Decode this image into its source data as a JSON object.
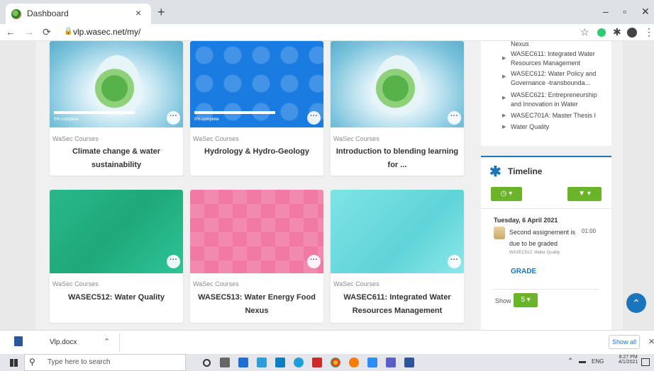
{
  "browser": {
    "tab_title": "Dashboard",
    "tab_close": "×",
    "new_tab": "+",
    "url": "vlp.wasec.net/my/",
    "window_min": "–",
    "window_max": "▫",
    "window_close": "✕"
  },
  "courses": [
    {
      "category": "WaSec Courses",
      "title": "Climate change & water sustainability",
      "progress_label": "0% complete",
      "progress": 0
    },
    {
      "category": "WaSec Courses",
      "title": "Hydrology & Hydro-Geology",
      "progress_label": "0% complete",
      "progress": 0
    },
    {
      "category": "WaSec Courses",
      "title": "Introduction to blending learning for ..."
    },
    {
      "category": "WaSec Courses",
      "title": "WASEC512: Water Quality"
    },
    {
      "category": "WaSec Courses",
      "title": "WASEC513: Water Energy Food Nexus"
    },
    {
      "category": "WaSec Courses",
      "title": "WASEC611: Integrated Water Resources Management"
    }
  ],
  "sidebar": {
    "partial_top": "Nexus",
    "items": [
      "WASEC611: Integrated Water Resources Management",
      "WASEC612: Water Policy and Governance -transbounda...",
      "WASEC621: Entrepreneurship and Innovation in Water",
      "WASEC701A: Master Thesis I",
      "Water Quality"
    ]
  },
  "timeline": {
    "title": "Timeline",
    "date": "Tuesday, 6 April 2021",
    "event_text": "Second assignement is due to be graded",
    "event_time": "01:00",
    "event_course": "WASEC512: Water Quality",
    "action": "GRADE",
    "show_label": "Show",
    "show_value": "5"
  },
  "download": {
    "file": "Vlp.docx",
    "show_all": "Show all",
    "close": "✕"
  },
  "taskbar": {
    "search_placeholder": "Type here to search",
    "language": "ENG",
    "time": "8:27 PM",
    "date": "4/1/2021"
  },
  "colors": {
    "accent_green": "#6bb42a",
    "accent_blue": "#1b75bb"
  }
}
